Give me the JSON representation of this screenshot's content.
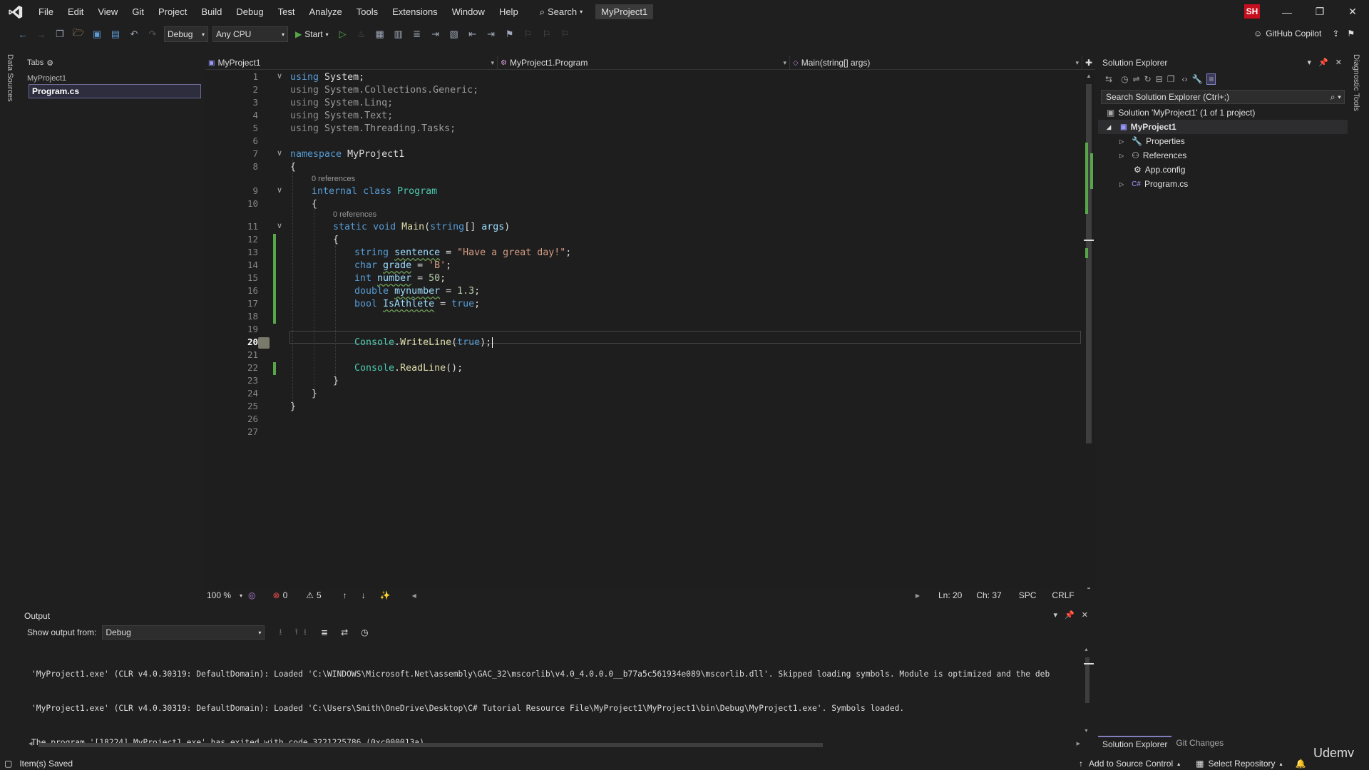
{
  "app": {
    "menu": [
      "File",
      "Edit",
      "View",
      "Git",
      "Project",
      "Build",
      "Debug",
      "Test",
      "Analyze",
      "Tools",
      "Extensions",
      "Window",
      "Help"
    ],
    "search_label": "Search",
    "project_name": "MyProject1",
    "user_initials": "SH"
  },
  "toolbar": {
    "config": "Debug",
    "platform": "Any CPU",
    "start_label": "Start",
    "copilot_label": "GitHub Copilot"
  },
  "rails": {
    "left_label": "Data Sources",
    "right_label": "Diagnostic Tools"
  },
  "tabs_panel": {
    "title": "Tabs",
    "group": "MyProject1",
    "active_file": "Program.cs"
  },
  "editor": {
    "nav_project": "MyProject1",
    "nav_class": "MyProject1.Program",
    "nav_member": "Main(string[] args)",
    "codelens_class": "0 references",
    "codelens_method": "0 references",
    "code": {
      "l1_kw": "using",
      "l1_id": "System;",
      "l2_kw": "using",
      "l2_id": "System.Collections.Generic;",
      "l3_kw": "using",
      "l3_id": "System.Linq;",
      "l4_kw": "using",
      "l4_id": "System.Text;",
      "l5_kw": "using",
      "l5_id": "System.Threading.Tasks;",
      "l7_kw": "namespace",
      "l7_id": "MyProject1",
      "l8": "{",
      "l9_kw1": "internal",
      "l9_kw2": "class",
      "l9_ty": "Program",
      "l10": "{",
      "l11_kw1": "static",
      "l11_kw2": "void",
      "l11_me": "Main",
      "l11_p1": "(",
      "l11_kw3": "string",
      "l11_p2": "[] ",
      "l11_arg": "args",
      "l11_p3": ")",
      "l12": "{",
      "l13_kw": "string",
      "l13_var": "sentence",
      "l13_eq": " = ",
      "l13_val": "\"Have a great day!\"",
      "l13_end": ";",
      "l14_kw": "char",
      "l14_var": "grade",
      "l14_eq": " = ",
      "l14_val": "'B'",
      "l14_end": ";",
      "l15_kw": "int",
      "l15_var": "number",
      "l15_eq": " = ",
      "l15_val": "50",
      "l15_end": ";",
      "l16_kw": "double",
      "l16_var": "mynumber",
      "l16_eq": " = ",
      "l16_val": "1.3",
      "l16_end": ";",
      "l17_kw": "bool",
      "l17_var": "IsAthlete",
      "l17_eq": " = ",
      "l17_val": "true",
      "l17_end": ";",
      "l20_ty": "Console",
      "l20_dot": ".",
      "l20_me": "WriteLine",
      "l20_p1": "(",
      "l20_kw": "true",
      "l20_p2": ");",
      "l22_ty": "Console",
      "l22_dot": ".",
      "l22_me": "ReadLine",
      "l22_p": "();",
      "l23": "}",
      "l24": "}",
      "l25": "}"
    },
    "line_numbers": [
      "1",
      "2",
      "3",
      "4",
      "5",
      "6",
      "7",
      "8",
      "9",
      "10",
      "11",
      "12",
      "13",
      "14",
      "15",
      "16",
      "17",
      "18",
      "19",
      "20",
      "21",
      "22",
      "23",
      "24",
      "25",
      "26",
      "27"
    ],
    "active_line": "20",
    "zoom": "100 %",
    "errors": "0",
    "warnings": "5",
    "position_ln": "Ln: 20",
    "position_ch": "Ch: 37",
    "whitespace": "SPC",
    "line_ending": "CRLF"
  },
  "output": {
    "title": "Output",
    "show_from_label": "Show output from:",
    "source": "Debug",
    "lines": [
      "'MyProject1.exe' (CLR v4.0.30319: DefaultDomain): Loaded 'C:\\WINDOWS\\Microsoft.Net\\assembly\\GAC_32\\mscorlib\\v4.0_4.0.0.0__b77a5c561934e089\\mscorlib.dll'. Skipped loading symbols. Module is optimized and the deb",
      "'MyProject1.exe' (CLR v4.0.30319: DefaultDomain): Loaded 'C:\\Users\\Smith\\OneDrive\\Desktop\\C# Tutorial Resource File\\MyProject1\\MyProject1\\bin\\Debug\\MyProject1.exe'. Symbols loaded.",
      "The program '[18224] MyProject1.exe' has exited with code 3221225786 (0xc000013a)."
    ]
  },
  "solution_explorer": {
    "title": "Solution Explorer",
    "search_placeholder": "Search Solution Explorer (Ctrl+;)",
    "solution_label": "Solution 'MyProject1' (1 of 1 project)",
    "project": "MyProject1",
    "items": [
      "Properties",
      "References",
      "App.config",
      "Program.cs"
    ],
    "tab_solution": "Solution Explorer",
    "tab_git": "Git Changes"
  },
  "statusbar": {
    "message": "Item(s) Saved",
    "source_control": "Add to Source Control",
    "repository": "Select Repository"
  },
  "watermark": "Udemy"
}
